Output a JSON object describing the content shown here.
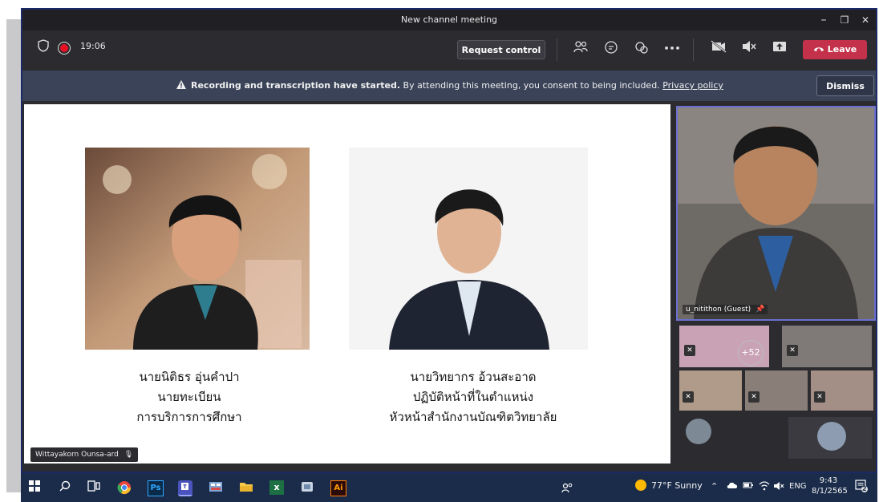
{
  "window": {
    "title": "New channel meeting",
    "controls": {
      "minimize": "–",
      "maximize": "❐",
      "close": "✕"
    }
  },
  "toolbar": {
    "timer": "19:06",
    "request_control": "Request control",
    "leave": "Leave",
    "more": "•••",
    "icons": [
      "shield-icon",
      "recording-icon",
      "people-icon",
      "chat-icon",
      "reactions-icon",
      "more-icon",
      "camera-off-icon",
      "speaker-mute-icon",
      "share-icon",
      "phone-icon"
    ]
  },
  "banner": {
    "bold": "Recording and transcription have started.",
    "text": " By attending this meeting, you consent to being included. ",
    "link": "Privacy policy",
    "dismiss": "Dismiss"
  },
  "stage": {
    "person1": {
      "name": "นายนิติธร อุ่นคำปา",
      "line2": "นายทะเบียน",
      "line3": "การบริการการศึกษา"
    },
    "person2": {
      "name": "นายวิทยากร อ้วนสะอาด",
      "line2": "ปฏิบัติหน้าที่ในตำแหน่ง",
      "line3": "หัวหน้าสำนักงานบัณฑิตวิทยาลัย"
    },
    "presenter_name": "Wittayakorn Ounsa-ard"
  },
  "side": {
    "pinned_name": "u_nitithon (Guest)",
    "more_count": "+52"
  },
  "taskbar": {
    "weather": "77°F Sunny",
    "lang": "ENG",
    "time": "9:43",
    "date": "8/1/2565",
    "notif_count": "2",
    "apps": [
      "start-icon",
      "search-icon",
      "task-view-icon",
      "chrome-icon",
      "photoshop-icon",
      "teams-icon",
      "app-icon",
      "file-explorer-icon",
      "excel-icon",
      "app2-icon",
      "illustrator-icon"
    ],
    "ps_label": "Ps",
    "ai_label": "Ai",
    "xl_label": "x"
  }
}
